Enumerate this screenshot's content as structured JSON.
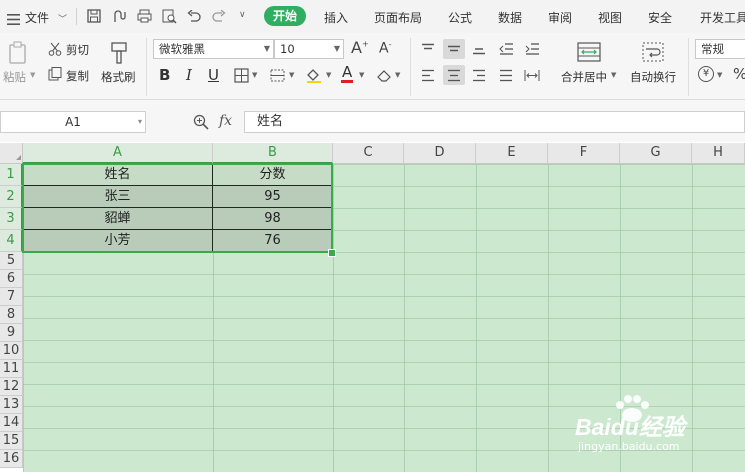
{
  "menubar": {
    "file_label": "文件",
    "tabs": [
      "开始",
      "插入",
      "页面布局",
      "公式",
      "数据",
      "审阅",
      "视图",
      "安全",
      "开发工具"
    ]
  },
  "ribbon": {
    "paste_label": "粘贴",
    "cut_label": "剪切",
    "copy_label": "复制",
    "format_painter_label": "格式刷",
    "font_name": "微软雅黑",
    "font_size": "10",
    "bold_glyph": "B",
    "italic_glyph": "I",
    "underline_glyph": "U",
    "merge_center_label": "合并居中",
    "wrap_text_label": "自动换行",
    "number_format": "常规",
    "currency_glyph": "¥",
    "percent_glyph": "%"
  },
  "formula_bar": {
    "name_box": "A1",
    "fx_label": "fx",
    "content": "姓名"
  },
  "grid": {
    "columns": [
      "A",
      "B",
      "C",
      "D",
      "E",
      "F",
      "G",
      "H"
    ],
    "rows": [
      "1",
      "2",
      "3",
      "4",
      "5",
      "6",
      "7",
      "8",
      "9",
      "10",
      "11",
      "12",
      "13",
      "14",
      "15",
      "16"
    ],
    "data": [
      [
        "姓名",
        "分数"
      ],
      [
        "张三",
        "95"
      ],
      [
        "貂蝉",
        "98"
      ],
      [
        "小芳",
        "76"
      ]
    ]
  },
  "watermark": {
    "brand": "Baidu经验",
    "url": "jingyan.baidu.com"
  },
  "colors": {
    "accent": "#2fae62",
    "selection_border": "#3aa84b",
    "sheet_background": "#cce8cf"
  }
}
